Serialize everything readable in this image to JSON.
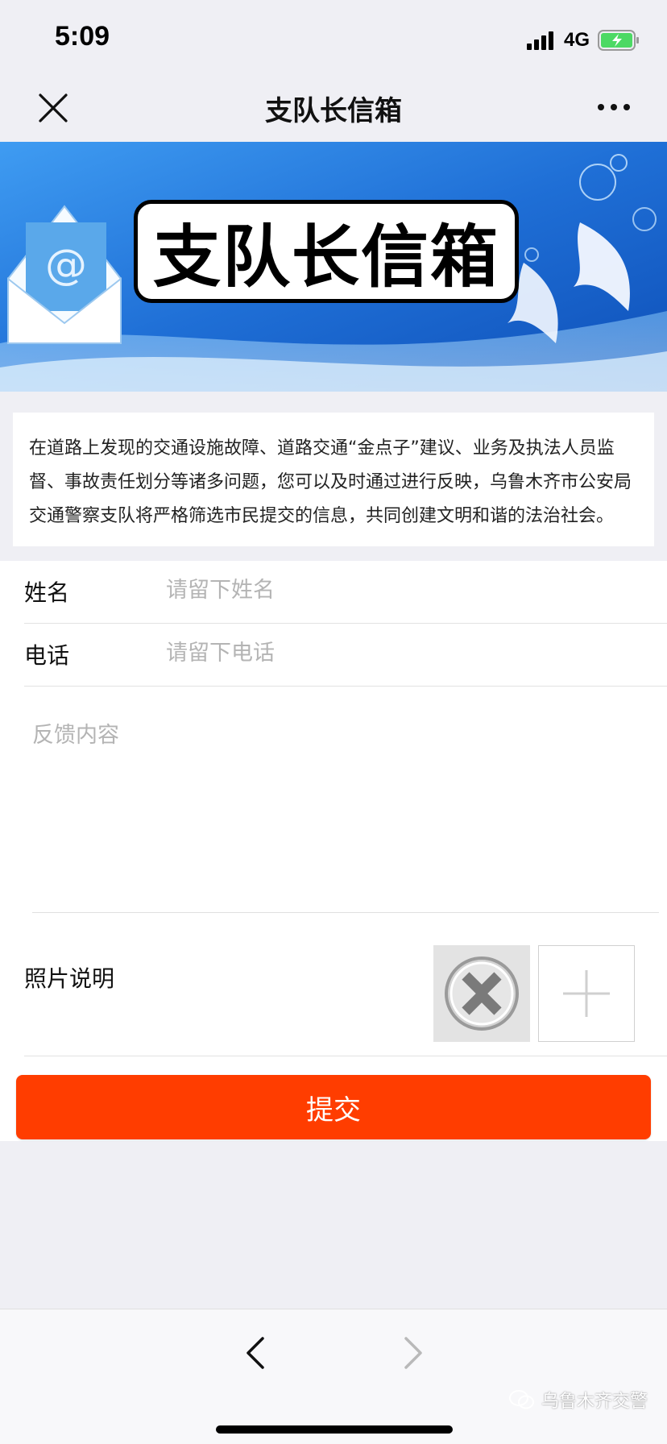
{
  "status_bar": {
    "time": "5:09",
    "network": "4G",
    "icons": [
      "signal-icon",
      "battery-charging-icon"
    ]
  },
  "nav": {
    "title": "支队长信箱",
    "close_icon": "close-icon",
    "more_icon": "more-icon"
  },
  "banner": {
    "title": "支队长信箱"
  },
  "intro": {
    "text": "在道路上发现的交通设施故障、道路交通“金点子”建议、业务及执法人员监督、事故责任划分等诸多问题，您可以及时通过进行反映，乌鲁木齐市公安局交通警察支队将严格筛选市民提交的信息，共同创建文明和谐的法治社会。"
  },
  "form": {
    "name_label": "姓名",
    "name_placeholder": "请留下姓名",
    "name_value": "",
    "phone_label": "电话",
    "phone_placeholder": "请留下电话",
    "phone_value": "",
    "feedback_placeholder": "反馈内容",
    "feedback_value": "",
    "photo_label": "照片说明",
    "photo_icons": [
      "remove-photo-icon",
      "add-photo-icon"
    ],
    "submit_label": "提交"
  },
  "toolbar": {
    "back_icon": "chevron-left-icon",
    "forward_icon": "chevron-right-icon",
    "watermark": "乌鲁木齐交警"
  },
  "colors": {
    "submit": "#ff3d00",
    "background": "#efeff4",
    "banner_blue": "#2a7fe0",
    "battery_green": "#4cd964"
  }
}
